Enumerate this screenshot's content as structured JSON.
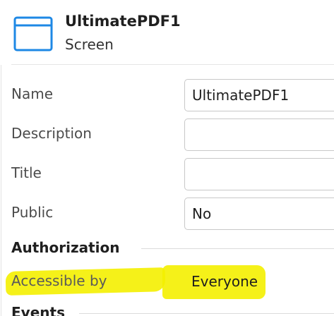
{
  "header": {
    "title": "UltimatePDF1",
    "subtitle": "Screen",
    "icon": "screen-window-icon",
    "icon_color": "#1e88e5"
  },
  "properties": [
    {
      "key": "name",
      "label": "Name",
      "value": "UltimatePDF1"
    },
    {
      "key": "description",
      "label": "Description",
      "value": ""
    },
    {
      "key": "title",
      "label": "Title",
      "value": ""
    },
    {
      "key": "public",
      "label": "Public",
      "value": "No"
    }
  ],
  "authorization": {
    "section_title": "Authorization",
    "accessible_by_label": "Accessible by",
    "accessible_by_value": "Everyone",
    "highlight_color": "#f4ef00"
  },
  "events": {
    "section_title": "Events"
  }
}
